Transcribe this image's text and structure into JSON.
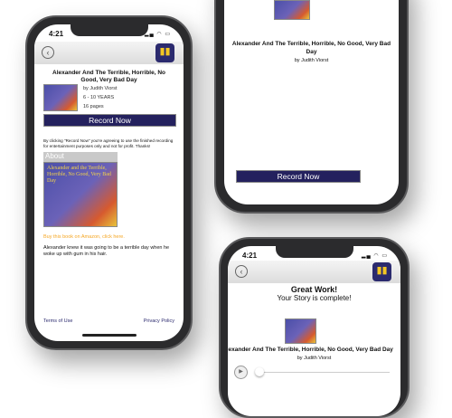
{
  "status_time": "4:21",
  "book": {
    "title": "Alexander And The Terrible, Horrible, No Good, Very Bad Day",
    "author": "by Judith Viorst",
    "age": "6 - 10 YEARS",
    "pages": "16 pages"
  },
  "record_label": "Record Now",
  "disclaimer": "By clicking \"Record Now\" you're agreeing to use the finished recording for entertainment purposes only and not for profit. Thanks!",
  "about_label": "About",
  "cover_title": "Alexander and the Terrible, Horrible, No Good, Very Bad Day",
  "amazon_link": "Buy this book on Amazon, click here.",
  "description": "Alexander knew it was going to be a terrible day when he woke up with gum in his hair.",
  "footer": {
    "terms": "Terms of Use",
    "privacy": "Privacy Policy"
  },
  "complete": {
    "heading": "Great Work!",
    "subheading": "Your Story is complete!"
  },
  "player": {
    "progress": 0
  }
}
